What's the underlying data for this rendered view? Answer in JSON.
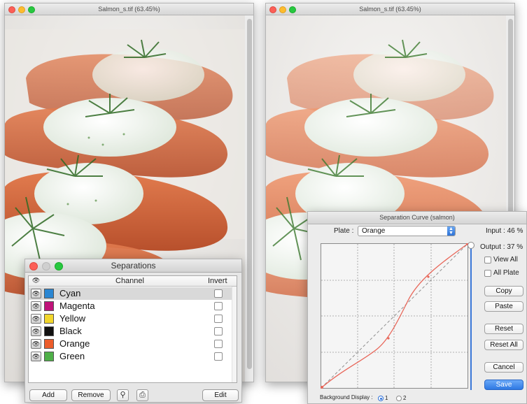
{
  "window_left": {
    "title": "Salmon_s.tif (63.45%)"
  },
  "window_right": {
    "title": "Salmon_s.tif (63.45%)"
  },
  "separations": {
    "title": "Separations",
    "col_channel": "Channel",
    "col_invert": "Invert",
    "rows": [
      {
        "label": "Cyan",
        "color": "#2a86d2",
        "selected": true
      },
      {
        "label": "Magenta",
        "color": "#c0147a"
      },
      {
        "label": "Yellow",
        "color": "#f2d62c"
      },
      {
        "label": "Black",
        "color": "#111111"
      },
      {
        "label": "Orange",
        "color": "#ec5c2a"
      },
      {
        "label": "Green",
        "color": "#4fb048"
      }
    ],
    "buttons": {
      "add": "Add",
      "remove": "Remove",
      "edit": "Edit"
    },
    "icons": {
      "search": "magnifier-icon",
      "print": "printer-icon"
    }
  },
  "curve": {
    "title": "Separation Curve (salmon)",
    "plate_label": "Plate :",
    "plate_value": "Orange",
    "input_label": "Input : 46 %",
    "output_label": "Output : 37 %",
    "view_all": "View All",
    "all_plate": "All Plate",
    "copy": "Copy",
    "paste": "Paste",
    "reset": "Reset",
    "reset_all": "Reset All",
    "cancel": "Cancel",
    "save": "Save",
    "bg_label": "Background Display :",
    "bg_option_1": "1",
    "bg_option_2": "2",
    "curve_color": "#e8675a",
    "accent": "#2e78e3"
  }
}
